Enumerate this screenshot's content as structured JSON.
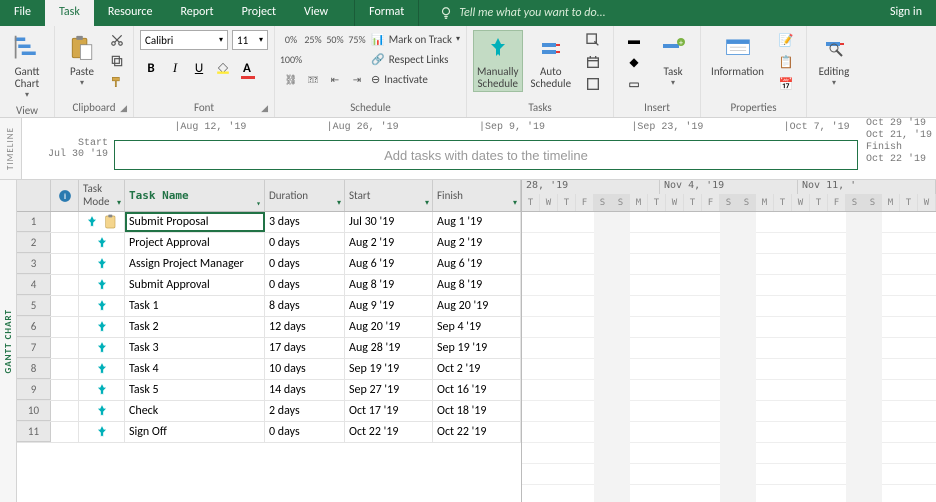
{
  "tabs": {
    "file": "File",
    "task": "Task",
    "resource": "Resource",
    "report": "Report",
    "project": "Project",
    "view": "View",
    "format": "Format",
    "tellme": "Tell me what you want to do...",
    "signin": "Sign in"
  },
  "ribbon": {
    "view": {
      "gantt": "Gantt\nChart",
      "label": "View"
    },
    "clipboard": {
      "paste": "Paste",
      "label": "Clipboard"
    },
    "font": {
      "name": "Calibri",
      "size": "11",
      "label": "Font"
    },
    "schedule": {
      "mark": "Mark on Track",
      "respect": "Respect Links",
      "inactivate": "Inactivate",
      "label": "Schedule"
    },
    "tasks": {
      "manual": "Manually\nSchedule",
      "auto": "Auto\nSchedule",
      "label": "Tasks"
    },
    "insert": {
      "task": "Task",
      "label": "Insert"
    },
    "properties": {
      "info": "Information",
      "label": "Properties"
    },
    "editing": {
      "label": "Editing"
    }
  },
  "timeline": {
    "side": "TIMELINE",
    "start_lbl": "Start",
    "start_date": "Jul 30 '19",
    "placeholder": "Add tasks with dates to the timeline",
    "finish_lbl": "Finish",
    "finish_date": "Oct 22 '19",
    "dates": [
      "",
      "Aug 12, '19",
      "Aug 26, '19",
      "Sep 9, '19",
      "Sep 23, '19",
      "Oct 7, '19"
    ],
    "end_dates": [
      "Oct 29 '19",
      "Oct 21, '19"
    ]
  },
  "columns": {
    "mode": "Task\nMode",
    "name": "Task Name",
    "duration": "Duration",
    "start": "Start",
    "finish": "Finish"
  },
  "rows": [
    {
      "n": "1",
      "name": "Submit Proposal",
      "dur": "3 days",
      "start": "Jul 30 '19",
      "finish": "Aug 1 '19",
      "clip": true
    },
    {
      "n": "2",
      "name": "Project Approval",
      "dur": "0 days",
      "start": "Aug 2 '19",
      "finish": "Aug 2 '19"
    },
    {
      "n": "3",
      "name": "Assign Project Manager",
      "dur": "0 days",
      "start": "Aug 6 '19",
      "finish": "Aug 6 '19"
    },
    {
      "n": "4",
      "name": "Submit Approval",
      "dur": "0 days",
      "start": "Aug 8 '19",
      "finish": "Aug 8 '19"
    },
    {
      "n": "5",
      "name": "Task 1",
      "dur": "8 days",
      "start": "Aug 9 '19",
      "finish": "Aug 20 '19"
    },
    {
      "n": "6",
      "name": "Task 2",
      "dur": "12 days",
      "start": "Aug 20 '19",
      "finish": "Sep 4 '19"
    },
    {
      "n": "7",
      "name": "Task 3",
      "dur": "17 days",
      "start": "Aug 28 '19",
      "finish": "Sep 19 '19"
    },
    {
      "n": "8",
      "name": "Task 4",
      "dur": "10 days",
      "start": "Sep 19 '19",
      "finish": "Oct 2 '19"
    },
    {
      "n": "9",
      "name": "Task 5",
      "dur": "14 days",
      "start": "Sep 27 '19",
      "finish": "Oct 16 '19"
    },
    {
      "n": "10",
      "name": "Check",
      "dur": "2 days",
      "start": "Oct 17 '19",
      "finish": "Oct 18 '19"
    },
    {
      "n": "11",
      "name": "Sign Off",
      "dur": "0 days",
      "start": "Oct 22 '19",
      "finish": "Oct 22 '19"
    }
  ],
  "gantt": {
    "side": "GANTT CHART",
    "weeks": [
      "28, '19",
      "Nov 4, '19",
      "Nov 11, '"
    ],
    "days": [
      "T",
      "W",
      "T",
      "F",
      "S",
      "S",
      "M",
      "T",
      "W",
      "T",
      "F",
      "S",
      "S",
      "M",
      "T",
      "W",
      "T",
      "F",
      "S",
      "S",
      "M",
      "T",
      "W"
    ]
  }
}
